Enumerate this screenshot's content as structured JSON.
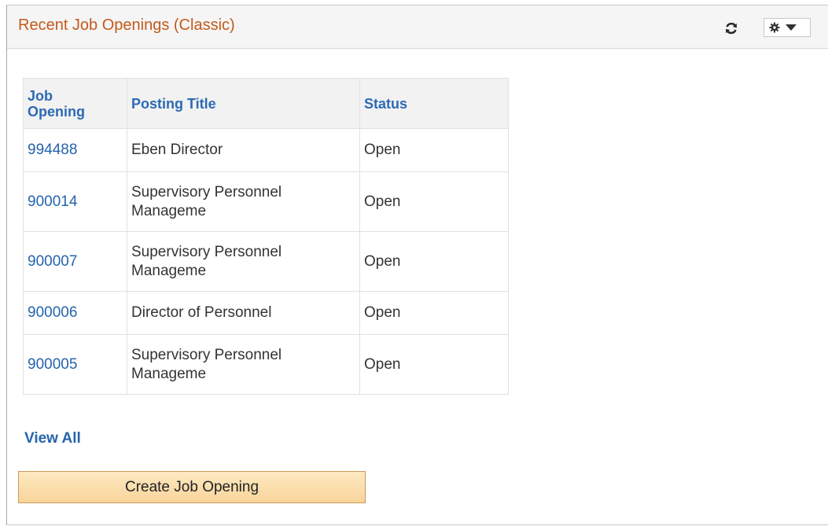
{
  "pagelet": {
    "title": "Recent Job Openings (Classic)",
    "icons": {
      "refresh": "refresh-icon",
      "actions": "gear-icon",
      "menu": "caret-down-icon"
    }
  },
  "table": {
    "headers": {
      "job_opening": "Job Opening",
      "posting_title": "Posting Title",
      "status": "Status"
    },
    "rows": [
      {
        "job_opening": "994488",
        "posting_title": "Eben Director",
        "status": "Open"
      },
      {
        "job_opening": "900014",
        "posting_title": "Supervisory Personnel Manageme",
        "status": "Open"
      },
      {
        "job_opening": "900007",
        "posting_title": "Supervisory Personnel Manageme",
        "status": "Open"
      },
      {
        "job_opening": "900006",
        "posting_title": "Director of Personnel",
        "status": "Open"
      },
      {
        "job_opening": "900005",
        "posting_title": "Supervisory Personnel Manageme",
        "status": "Open"
      }
    ]
  },
  "links": {
    "view_all": "View All"
  },
  "buttons": {
    "create_job_opening": "Create Job Opening"
  },
  "colors": {
    "title": "#c35a1a",
    "link": "#2563ad",
    "button": "#f9d49a"
  }
}
